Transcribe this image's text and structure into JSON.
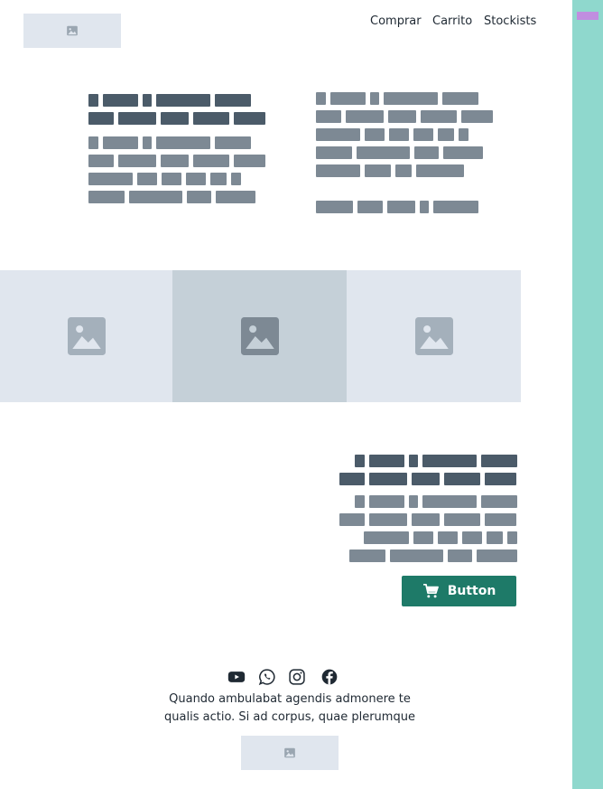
{
  "header": {
    "logo_icon": "image-icon",
    "nav": [
      {
        "label": "Comprar"
      },
      {
        "label": "Carrito"
      },
      {
        "label": "Stockists"
      }
    ]
  },
  "gallery": {
    "icons": [
      "image-icon",
      "image-icon",
      "image-icon"
    ]
  },
  "cta": {
    "button_label": "Button",
    "button_icon": "cart-icon"
  },
  "footer": {
    "social": [
      "youtube-icon",
      "whatsapp-icon",
      "instagram-icon",
      "facebook-icon"
    ],
    "text": "Quando ambulabat agendis admonere te qualis actio. Si ad corpus, quae plerumque",
    "logo_icon": "image-icon"
  },
  "colors": {
    "sidebar": "#8fd8cd",
    "sidebar_tab": "#c08ee0",
    "button": "#1e7a68",
    "placeholder": "#e0e6ee",
    "placeholder_alt": "#c5d0d8",
    "text_dark": "#4b5b69",
    "text_mid": "#7d8994"
  }
}
